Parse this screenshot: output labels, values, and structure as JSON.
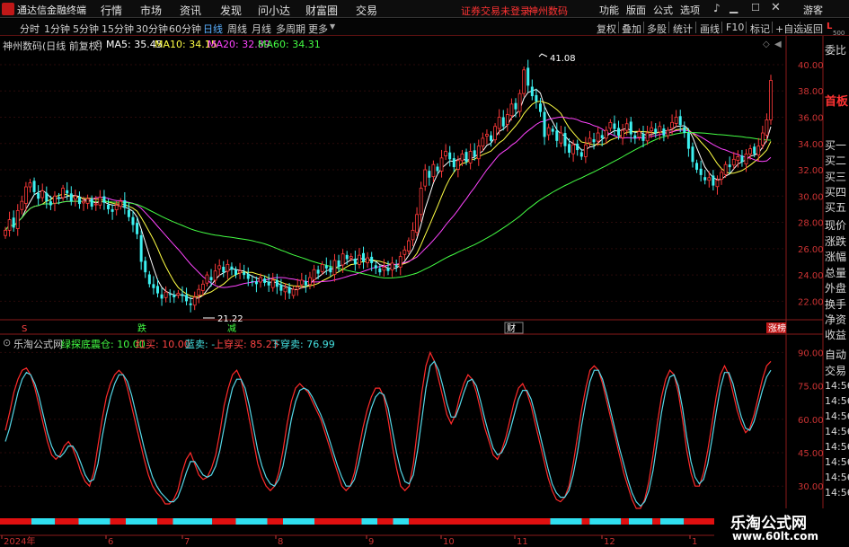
{
  "app": {
    "logo_text": "通达信金融终端",
    "menus": [
      "行情",
      "市场",
      "资讯",
      "发现",
      "问小达",
      "财富圈",
      "交易"
    ],
    "status_text": "证券交易未登录",
    "stock_title": "神州数码",
    "right_menus": [
      "功能",
      "版面",
      "公式",
      "选项"
    ],
    "guest_label": "游客",
    "colors": {
      "accent": "#ff3333",
      "bg": "#000000",
      "up": "#ff3a3a",
      "down": "#3cf0f0"
    }
  },
  "toolbar": {
    "periods": [
      "分时",
      "1分钟",
      "5分钟",
      "15分钟",
      "30分钟",
      "60分钟",
      "日线",
      "周线",
      "月线",
      "多周期",
      "更多"
    ],
    "active_period": "日线",
    "right_buttons": [
      "复权",
      "叠加",
      "多股",
      "统计",
      "画线",
      "F10",
      "标记",
      "+自选",
      "返回"
    ]
  },
  "main_chart": {
    "title": "神州数码(日线 前复权)",
    "ma_labels": [
      {
        "label": "MA5: 35.45",
        "color": "#ffffff"
      },
      {
        "label": "MA10: 34.15",
        "color": "#ffff44"
      },
      {
        "label": "MA20: 32.89",
        "color": "#ff44ff"
      },
      {
        "label": "MA60: 34.31",
        "color": "#44ff44"
      }
    ],
    "high_label": "41.08",
    "low_label": "21.22",
    "y_ticks": [
      "40.00",
      "38.00",
      "36.00",
      "34.00",
      "32.00",
      "30.00",
      "28.00",
      "26.00",
      "24.00",
      "22.00"
    ],
    "markers": [
      {
        "label": "S",
        "color": "#ff4444"
      },
      {
        "label": "跌",
        "color": "#44ff44"
      },
      {
        "label": "减",
        "color": "#44ff44"
      },
      {
        "label": "财",
        "color": "#ffffff"
      },
      {
        "label": "涨榜",
        "color": "#ffffff"
      }
    ]
  },
  "indicator": {
    "name": "乐淘公式网",
    "values": [
      {
        "label": "绿探底震仓: 10.00",
        "color": "#44ff44"
      },
      {
        "label": "红买: 10.00",
        "color": "#ff4444"
      },
      {
        "label": "蓝卖: -",
        "color": "#44e0e0"
      },
      {
        "label": "上穿买: 85.23",
        "color": "#ff4444"
      },
      {
        "label": "下穿卖: 76.99",
        "color": "#44e0e0"
      }
    ],
    "y_ticks": [
      "90.00",
      "75.00",
      "60.00",
      "45.00",
      "30.00"
    ]
  },
  "x_axis": {
    "labels": [
      "2024年",
      "6",
      "7",
      "8",
      "9",
      "10",
      "11",
      "12",
      "1"
    ]
  },
  "right_panel": {
    "top_label": "L",
    "top_sub": "500",
    "items": [
      "委比",
      "首板",
      "买一",
      "买二",
      "买三",
      "买四",
      "买五",
      "现价",
      "涨跌",
      "涨幅",
      "总量",
      "外盘",
      "换手",
      "净资",
      "收益",
      "自动",
      "交易"
    ],
    "times": [
      "14:56",
      "14:56",
      "14:56",
      "14:56",
      "14:56",
      "14:56",
      "14:56",
      "14:56"
    ]
  },
  "watermark": {
    "line1": "乐淘公式网",
    "line2": "www.60lt.com"
  },
  "chart_data": [
    {
      "type": "candlestick",
      "title": "神州数码(日线 前复权)",
      "ylim": [
        21,
        41.5
      ],
      "series": [
        {
          "name": "close",
          "values": [
            27.4,
            28.2,
            27.6,
            28.9,
            29.6,
            30.7,
            31.0,
            30.3,
            29.8,
            30.4,
            29.6,
            29.3,
            30.0,
            29.8,
            30.6,
            30.2,
            29.6,
            30.0,
            29.4,
            29.6,
            29.8,
            29.2,
            29.4,
            29.9,
            29.5,
            29.0,
            28.8,
            29.3,
            29.6,
            29.1,
            28.4,
            27.8,
            27.1,
            25.0,
            24.2,
            23.3,
            23.0,
            22.6,
            22.2,
            22.7,
            22.5,
            22.3,
            22.6,
            22.4,
            22.0,
            21.7,
            22.3,
            22.9,
            23.3,
            24.0,
            23.6,
            24.3,
            24.7,
            24.2,
            24.8,
            24.4,
            24.0,
            24.3,
            24.0,
            23.7,
            23.5,
            23.3,
            23.8,
            23.4,
            23.2,
            23.6,
            23.1,
            22.8,
            23.0,
            22.6,
            22.9,
            23.1,
            23.6,
            23.2,
            23.8,
            24.4,
            24.1,
            24.8,
            24.5,
            24.2,
            25.1,
            24.6,
            25.6,
            25.2,
            25.4,
            24.8,
            25.5,
            25.0,
            25.3,
            24.9,
            24.5,
            24.2,
            24.6,
            24.3,
            24.9,
            24.6,
            25.4,
            25.9,
            26.6,
            27.4,
            28.6,
            30.6,
            32.0,
            31.4,
            32.4,
            31.9,
            32.9,
            33.4,
            32.8,
            32.2,
            32.7,
            33.2,
            32.6,
            33.4,
            33.0,
            33.8,
            34.4,
            34.7,
            34.2,
            35.3,
            36.0,
            35.3,
            36.2,
            37.0,
            36.6,
            37.8,
            39.6,
            38.4,
            37.6,
            37.2,
            36.4,
            34.5,
            35.2,
            34.9,
            34.2,
            34.8,
            33.8,
            33.3,
            33.9,
            33.5,
            33.0,
            33.9,
            34.4,
            34.1,
            34.8,
            34.4,
            35.0,
            35.6,
            35.1,
            34.6,
            35.0,
            35.5,
            34.7,
            34.4,
            34.9,
            34.2,
            34.8,
            35.2,
            34.8,
            35.3,
            34.6,
            35.0,
            35.6,
            36.0,
            35.4,
            34.8,
            33.6,
            32.6,
            32.0,
            31.6,
            31.2,
            31.4,
            30.8,
            31.2,
            31.8,
            32.4,
            32.2,
            32.8,
            33.0,
            32.6,
            33.2,
            33.6,
            33.2,
            33.8,
            34.8,
            35.8,
            38.8
          ]
        }
      ]
    },
    {
      "type": "line",
      "title": "乐淘公式网",
      "ylim": [
        20,
        95
      ],
      "series": [
        {
          "name": "上穿买",
          "values": [
            55,
            63,
            72,
            78,
            82,
            83,
            80,
            74,
            66,
            58,
            50,
            44,
            42,
            44,
            48,
            50,
            47,
            42,
            36,
            32,
            30,
            36,
            48,
            60,
            70,
            76,
            80,
            82,
            80,
            74,
            66,
            58,
            50,
            42,
            35,
            30,
            27,
            25,
            22,
            22,
            24,
            28,
            36,
            42,
            45,
            40,
            35,
            33,
            34,
            38,
            44,
            54,
            66,
            74,
            80,
            82,
            78,
            70,
            60,
            50,
            40,
            34,
            30,
            28,
            30,
            36,
            46,
            58,
            68,
            74,
            76,
            74,
            72,
            68,
            64,
            60,
            54,
            48,
            42,
            36,
            30,
            28,
            30,
            36,
            46,
            56,
            64,
            70,
            74,
            74,
            70,
            60,
            48,
            38,
            30,
            28,
            30,
            40,
            56,
            72,
            84,
            90,
            86,
            78,
            70,
            62,
            58,
            62,
            70,
            76,
            80,
            78,
            72,
            64,
            56,
            50,
            44,
            42,
            46,
            52,
            60,
            68,
            74,
            76,
            72,
            66,
            58,
            50,
            42,
            34,
            28,
            24,
            23,
            25,
            30,
            40,
            52,
            64,
            74,
            82,
            84,
            82,
            76,
            68,
            60,
            52,
            44,
            36,
            30,
            24,
            20,
            20,
            24,
            32,
            44,
            58,
            70,
            78,
            82,
            80,
            72,
            60,
            46,
            36,
            30,
            30,
            36,
            46,
            58,
            70,
            80,
            84,
            80,
            72,
            64,
            58,
            54,
            56,
            62,
            70,
            78,
            84,
            86
          ]
        },
        {
          "name": "下穿卖",
          "values": [
            50,
            56,
            64,
            72,
            78,
            81,
            80,
            76,
            70,
            62,
            54,
            48,
            44,
            43,
            45,
            48,
            48,
            45,
            40,
            35,
            32,
            33,
            40,
            52,
            62,
            70,
            76,
            80,
            80,
            77,
            71,
            63,
            55,
            47,
            40,
            34,
            30,
            27,
            25,
            23,
            23,
            25,
            30,
            36,
            41,
            41,
            38,
            35,
            34,
            35,
            39,
            46,
            56,
            66,
            74,
            78,
            78,
            74,
            66,
            56,
            46,
            39,
            34,
            31,
            30,
            33,
            39,
            49,
            60,
            68,
            73,
            74,
            73,
            70,
            66,
            62,
            57,
            51,
            45,
            39,
            34,
            30,
            30,
            33,
            40,
            49,
            58,
            65,
            70,
            72,
            71,
            65,
            55,
            45,
            37,
            32,
            31,
            35,
            46,
            60,
            74,
            84,
            86,
            82,
            75,
            67,
            61,
            61,
            66,
            72,
            77,
            78,
            75,
            68,
            60,
            53,
            47,
            44,
            45,
            49,
            55,
            62,
            69,
            73,
            73,
            69,
            62,
            54,
            46,
            38,
            31,
            27,
            25,
            25,
            28,
            35,
            45,
            57,
            68,
            77,
            82,
            82,
            78,
            71,
            63,
            55,
            47,
            40,
            33,
            27,
            23,
            21,
            23,
            28,
            37,
            50,
            63,
            73,
            79,
            80,
            75,
            65,
            52,
            41,
            34,
            31,
            33,
            40,
            51,
            63,
            74,
            81,
            81,
            76,
            68,
            61,
            56,
            55,
            59,
            66,
            73,
            79,
            82
          ]
        }
      ]
    }
  ]
}
